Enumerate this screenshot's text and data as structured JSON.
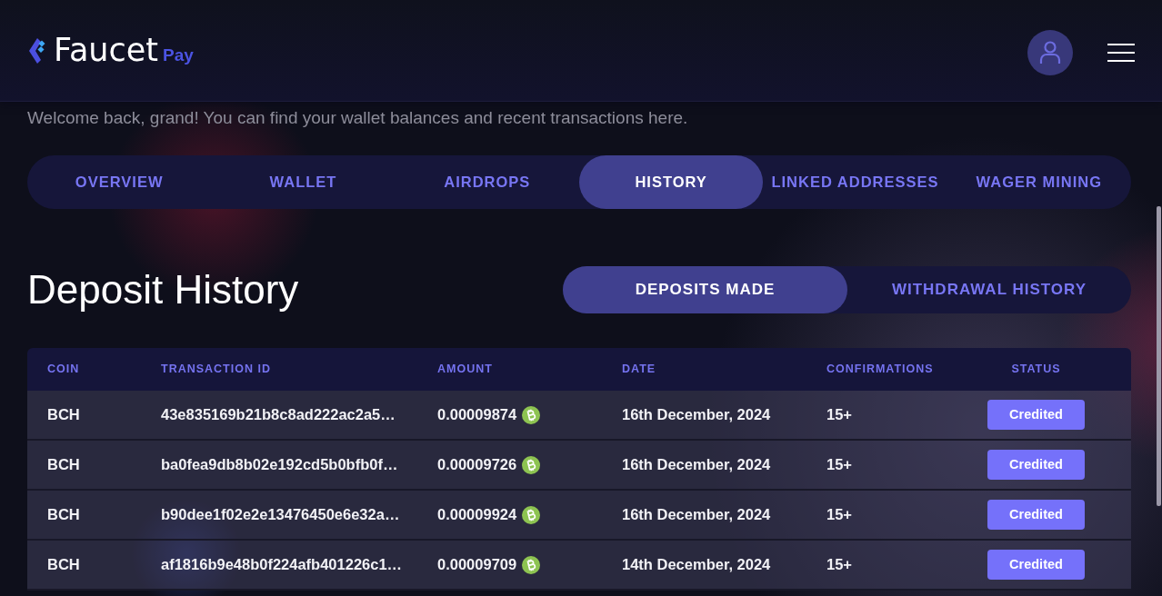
{
  "header": {
    "logo": {
      "wordmark": "Faucet",
      "suffix": "Pay"
    }
  },
  "welcome": "Welcome back, grand! You can find your wallet balances and recent transactions here.",
  "tabs": [
    {
      "label": "OVERVIEW",
      "selected": false
    },
    {
      "label": "WALLET",
      "selected": false
    },
    {
      "label": "AIRDROPS",
      "selected": false
    },
    {
      "label": "HISTORY",
      "selected": true
    },
    {
      "label": "LINKED ADDRESSES",
      "selected": false
    },
    {
      "label": "WAGER MINING",
      "selected": false
    }
  ],
  "section": {
    "title": "Deposit History",
    "toggle": [
      {
        "label": "DEPOSITS MADE",
        "selected": true
      },
      {
        "label": "WITHDRAWAL HISTORY",
        "selected": false
      }
    ]
  },
  "table": {
    "columns": [
      "COIN",
      "TRANSACTION ID",
      "AMOUNT",
      "DATE",
      "CONFIRMATIONS",
      "STATUS"
    ],
    "rows": [
      {
        "coin": "BCH",
        "transaction_id": "43e835169b21b8c8ad222ac2a5…",
        "amount": "0.00009874",
        "date": "16th December, 2024",
        "confirmations": "15+",
        "status": "Credited"
      },
      {
        "coin": "BCH",
        "transaction_id": "ba0fea9db8b02e192cd5b0bfb0f…",
        "amount": "0.00009726",
        "date": "16th December, 2024",
        "confirmations": "15+",
        "status": "Credited"
      },
      {
        "coin": "BCH",
        "transaction_id": "b90dee1f02e2e13476450e6e32a…",
        "amount": "0.00009924",
        "date": "16th December, 2024",
        "confirmations": "15+",
        "status": "Credited"
      },
      {
        "coin": "BCH",
        "transaction_id": "af1816b9e48b0f224afb401226c1…",
        "amount": "0.00009709",
        "date": "14th December, 2024",
        "confirmations": "15+",
        "status": "Credited"
      }
    ]
  }
}
